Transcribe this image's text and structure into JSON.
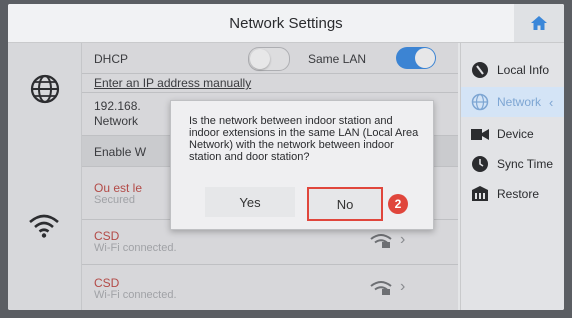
{
  "header": {
    "title": "Network Settings",
    "home_icon": "home-icon"
  },
  "rows": {
    "dhcp_label": "DHCP",
    "same_lan_label": "Same LAN",
    "manual_ip_label": "Enter an IP address manually",
    "ip_partial": "192.168.",
    "network_partial": "Network",
    "enable_partial": "Enable W",
    "wifi1_name": "Ou est le",
    "wifi1_status": "Secured",
    "wifi2_name": "CSD",
    "wifi2_status": "Wi-Fi connected.",
    "wifi3_name": "CSD",
    "wifi3_status": "Wi-Fi connected."
  },
  "dialog": {
    "message": "Is the network between indoor station and indoor extensions in the same LAN (Local Area Network) with the network between indoor station and door station?",
    "yes_label": "Yes",
    "no_label": "No",
    "badge": "2"
  },
  "sidebar": {
    "items": [
      {
        "label": "Local Info",
        "icon": "local-info-icon"
      },
      {
        "label": "Network",
        "icon": "globe-icon",
        "active": true
      },
      {
        "label": "Device",
        "icon": "device-icon"
      },
      {
        "label": "Sync Time",
        "icon": "clock-icon"
      },
      {
        "label": "Restore",
        "icon": "restore-icon"
      }
    ]
  },
  "colors": {
    "accent": "#2f87e6",
    "highlight": "#e0463c",
    "active_nav": "#d4e4f6"
  }
}
